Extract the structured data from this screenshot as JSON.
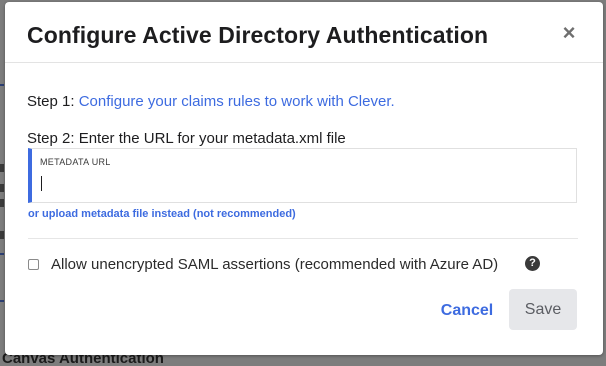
{
  "modal": {
    "title": "Configure Active Directory Authentication",
    "close_label": "×",
    "step1_prefix": "Step 1: ",
    "step1_link": "Configure your claims rules to work with Clever.",
    "step2_text": "Step 2: Enter the URL for your metadata.xml file",
    "metadata_field": {
      "label": "METADATA URL",
      "value": "",
      "placeholder": ""
    },
    "upload_link": "or upload metadata file instead (not recommended)",
    "unencrypted_checkbox": {
      "label": "Allow unencrypted SAML assertions (recommended with Azure AD)",
      "checked": false
    },
    "help_icon_glyph": "?",
    "cancel_label": "Cancel",
    "save_label": "Save"
  },
  "background": {
    "heading": "Canvas Authentication"
  },
  "colors": {
    "accent": "#3d6be0",
    "overlay": "#7d7d7d",
    "save_button_bg": "#e6e7ea"
  }
}
